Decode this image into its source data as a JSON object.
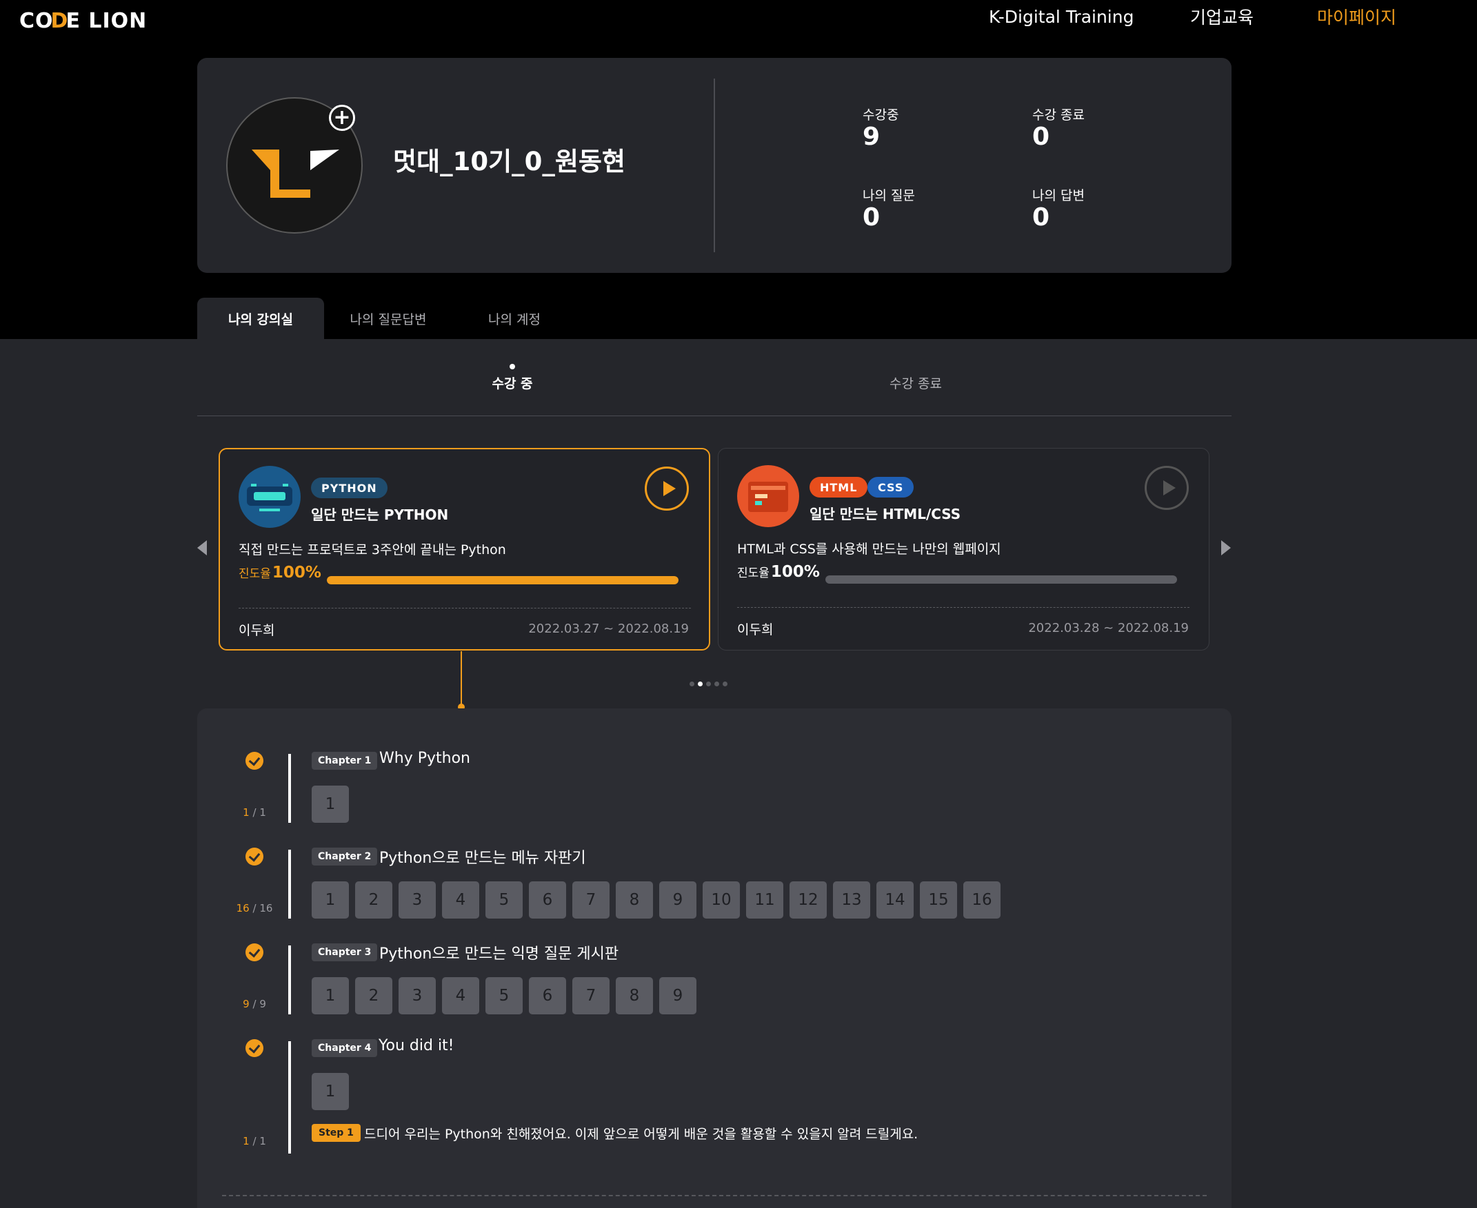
{
  "header": {
    "logo": {
      "part1": "CO",
      "slash": "D",
      "part2": "E LION"
    },
    "nav": [
      "K-Digital Training",
      "기업교육",
      "마이페이지"
    ]
  },
  "profile": {
    "name": "멋대_10기_0_원동현",
    "add_label": "+",
    "stats": [
      {
        "label": "수강중",
        "value": "9"
      },
      {
        "label": "수강 종료",
        "value": "0"
      },
      {
        "label": "나의 질문",
        "value": "0"
      },
      {
        "label": "나의 답변",
        "value": "0"
      }
    ]
  },
  "main_tabs": [
    "나의 강의실",
    "나의 질문답변",
    "나의 계정"
  ],
  "sub_tabs": [
    "수강 중",
    "수강 종료"
  ],
  "courses": [
    {
      "tags": [
        "PYTHON"
      ],
      "title": "일단 만드는 PYTHON",
      "desc": "직접 만드는 프로덕트로 3주안에 끝내는 Python",
      "progress_label": "진도율",
      "progress_text": "100%",
      "progress": 100,
      "instructor": "이두희",
      "period": "2022.03.27 ~ 2022.08.19"
    },
    {
      "tags": [
        "HTML",
        "CSS"
      ],
      "title": "일단 만드는 HTML/CSS",
      "desc": "HTML과 CSS를 사용해 만드는 나만의 웹페이지",
      "progress_label": "진도율",
      "progress_text": "100%",
      "progress": 100,
      "instructor": "이두희",
      "period": "2022.03.28 ~ 2022.08.19"
    }
  ],
  "chapters": [
    {
      "badge": "Chapter 1",
      "title": "Why Python",
      "done": "1",
      "sep": "/",
      "total": "1",
      "lessons": [
        "1"
      ]
    },
    {
      "badge": "Chapter 2",
      "title": "Python으로 만드는 메뉴 자판기",
      "done": "16",
      "sep": "/",
      "total": "16",
      "lessons": [
        "1",
        "2",
        "3",
        "4",
        "5",
        "6",
        "7",
        "8",
        "9",
        "10",
        "11",
        "12",
        "13",
        "14",
        "15",
        "16"
      ]
    },
    {
      "badge": "Chapter 3",
      "title": "Python으로 만드는 익명 질문 게시판",
      "done": "9",
      "sep": "/",
      "total": "9",
      "lessons": [
        "1",
        "2",
        "3",
        "4",
        "5",
        "6",
        "7",
        "8",
        "9"
      ]
    },
    {
      "badge": "Chapter 4",
      "title": "You did it!",
      "done": "1",
      "sep": "/",
      "total": "1",
      "lessons": [
        "1"
      ],
      "step": {
        "badge": "Step 1",
        "text": "드디어 우리는 Python와 친해졌어요. 이제 앞으로 어떻게 배운 것을 활용할 수 있을지 알려 드릴게요."
      }
    }
  ],
  "colors": {
    "accent": "#f29d1c",
    "python_tag": "#1f4c6e",
    "html_tag": "#e84e1c",
    "css_tag": "#1f5fb4",
    "progress_gray": "#5d5e64"
  }
}
